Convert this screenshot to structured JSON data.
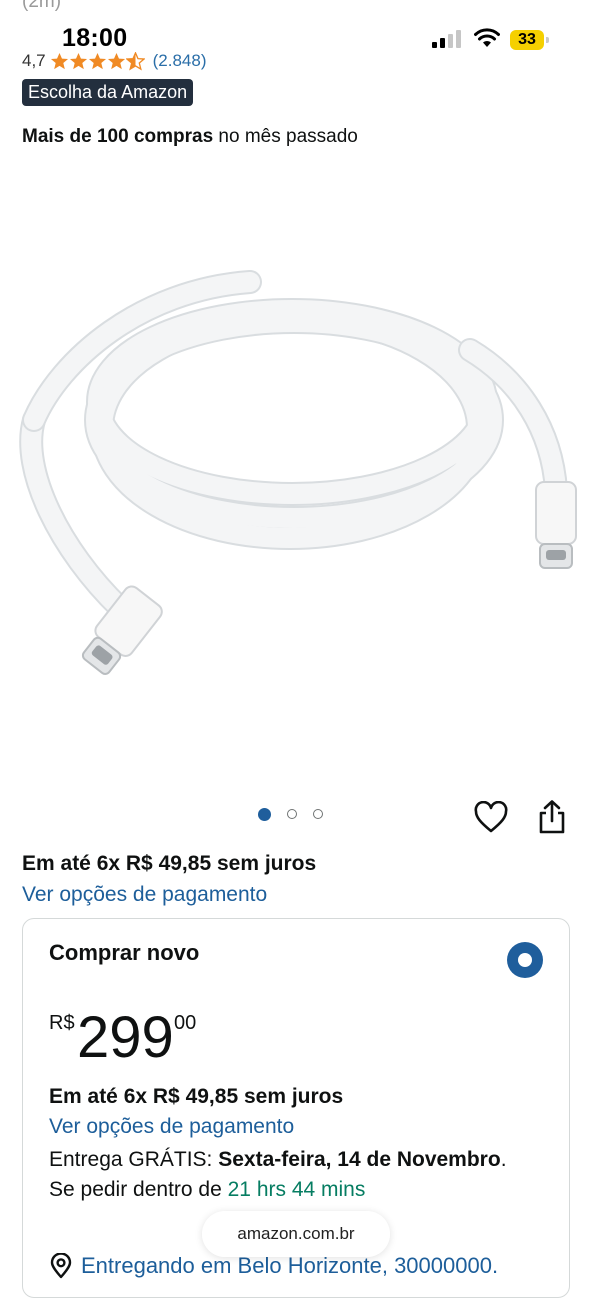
{
  "title_faded": {
    "line1": "",
    "line2": "(2m)"
  },
  "status_bar": {
    "time": "18:00",
    "battery": "33"
  },
  "rating": {
    "value": "4,7",
    "stars": 4.5,
    "count": "(2.848)"
  },
  "badge": "Escolha da Amazon",
  "purchases": {
    "bold": "Mais de 100 compras",
    "rest": " no mês passado"
  },
  "image_carousel": {
    "count": 3,
    "active": 1
  },
  "installments": "Em até 6x R$ 49,85 sem juros",
  "payment_link": "Ver opções de pagamento",
  "buy_box": {
    "title": "Comprar novo",
    "price": {
      "currency": "R$",
      "whole": "299",
      "cents": "00"
    },
    "installments": "Em até 6x R$ 49,85 sem juros",
    "payment_link": "Ver opções de pagamento",
    "delivery": {
      "prefix": "Entrega GRÁTIS: ",
      "date": "Sexta-feira, 14 de Novembro",
      "middle": ". Se pedir dentro de ",
      "countdown": "21 hrs 44 mins"
    },
    "location": "Entregando em Belo Horizonte, 30000000."
  },
  "url": "amazon.com.br",
  "colors": {
    "link": "#1d5e9a",
    "badge_bg": "#232f3e",
    "star": "#f08a24",
    "green": "#067d62",
    "active_dot": "#1f5e9c"
  }
}
